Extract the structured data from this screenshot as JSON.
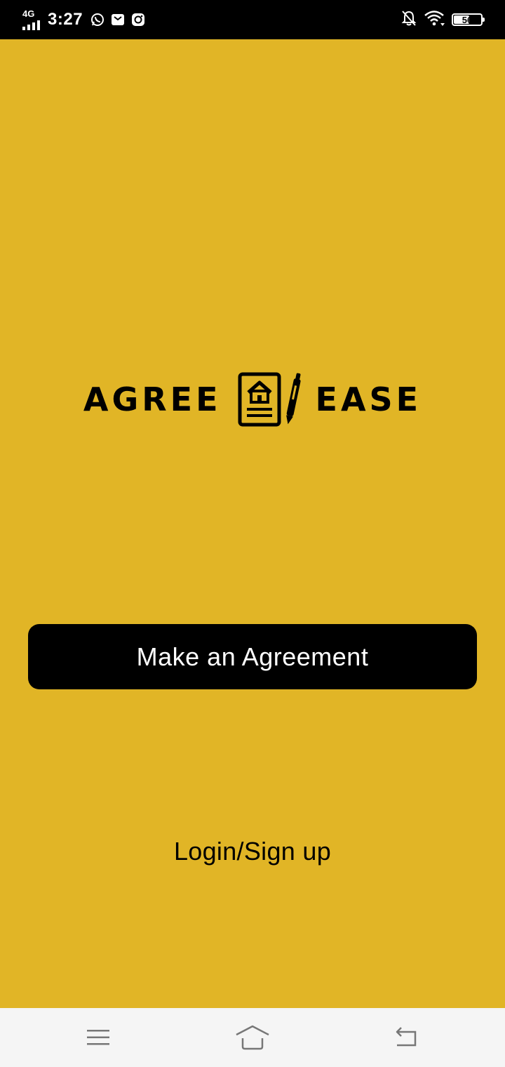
{
  "status_bar": {
    "network": "4G",
    "time": "3:27",
    "notification_icons": [
      "whatsapp-icon",
      "mail-bag-icon",
      "instagram-icon"
    ],
    "right_icons": [
      "notifications-off-icon",
      "wifi-icon"
    ],
    "battery_level": "56",
    "battery_fraction": 0.56
  },
  "logo": {
    "word_left": "AGREE",
    "word_right": "EASE",
    "mark_icon": "house-document-pen-icon"
  },
  "actions": {
    "primary_label": "Make an Agreement",
    "login_label": "Login/Sign up"
  },
  "nav_bar": {
    "buttons": [
      "menu-icon",
      "home-icon",
      "back-icon"
    ]
  },
  "colors": {
    "background": "#e1b526",
    "button": "#000000",
    "button_text": "#ffffff",
    "status_bar": "#000000",
    "nav_bar": "#f5f5f5"
  }
}
